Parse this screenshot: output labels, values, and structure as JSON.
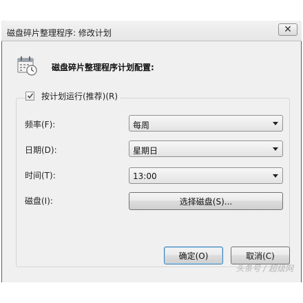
{
  "window": {
    "title": "磁盘碎片整理程序: 修改计划",
    "close_glyph": "✕"
  },
  "header": {
    "text": "磁盘碎片整理程序计划配置:",
    "icon": "calendar-clock-icon"
  },
  "schedule_checkbox": {
    "label": "按计划运行(推荐)(R)",
    "checked": true
  },
  "fields": {
    "frequency": {
      "label": "频率(F):",
      "value": "每周"
    },
    "day": {
      "label": "日期(D):",
      "value": "星期日"
    },
    "time": {
      "label": "时间(T):",
      "value": "13:00"
    },
    "disks": {
      "label": "磁盘(I):",
      "button": "选择磁盘(S)..."
    }
  },
  "buttons": {
    "ok": "确定(O)",
    "cancel": "取消(C)"
  },
  "watermark": "头条号 / 超级网"
}
